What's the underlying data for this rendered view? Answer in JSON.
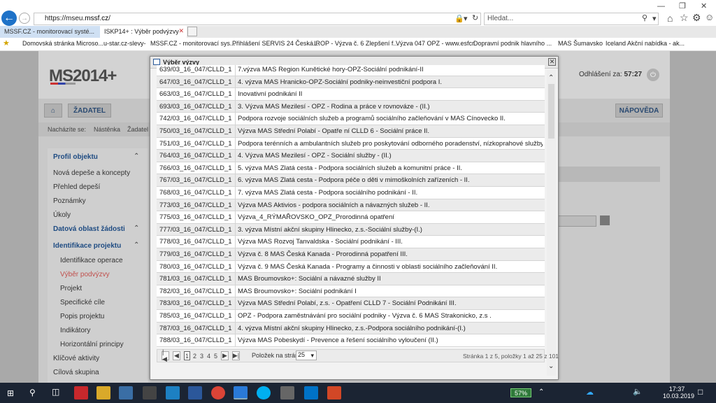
{
  "browser": {
    "url_prefix": "https://mseu.",
    "url_domain": "mssf.cz",
    "url_suffix": "/",
    "search_placeholder": "Hledat...",
    "tabs": [
      {
        "label": "MSSF.CZ - monitorovací systé..."
      },
      {
        "label": "ISKP14+ : Výběr podvýzvy"
      }
    ],
    "favorites": [
      "Domovská stránka Microso...",
      "u-star.cz-slevy-",
      "MSSF.CZ - monitorovací sys...",
      "Přihlášení SERVIS 24 Česká...",
      "IROP - Výzva č. 6 Zlepšení f...",
      "Výzva 047 OPZ - www.esfcr",
      "Dopravní podnik hlavního ...",
      "MAS Šumavsko",
      "Iceland",
      "Akční nabídka - ak..."
    ]
  },
  "page": {
    "logo": "MS2014+",
    "logout_label": "Odhlášení za:",
    "logout_time": "57:27",
    "nav": {
      "zadatel": "ŽADATEL",
      "napoveda": "NÁPOVĚDA"
    },
    "crumbs": {
      "label": "Nacházíte se:",
      "c1": "Nástěnka",
      "c2": "Žadatel"
    },
    "sidebar": [
      {
        "label": "Profil objektu",
        "type": "head"
      },
      {
        "label": "Nová depeše a koncepty",
        "type": "item"
      },
      {
        "label": "Přehled depeší",
        "type": "item"
      },
      {
        "label": "Poznámky",
        "type": "item"
      },
      {
        "label": "Úkoly",
        "type": "item"
      },
      {
        "label": "Datová oblast žádosti",
        "type": "head"
      },
      {
        "label": "Identifikace projektu",
        "type": "head"
      },
      {
        "label": "Identifikace operace",
        "type": "sub"
      },
      {
        "label": "Výběr podvýzvy",
        "type": "sub-active"
      },
      {
        "label": "Projekt",
        "type": "sub"
      },
      {
        "label": "Specifické cíle",
        "type": "sub"
      },
      {
        "label": "Popis projektu",
        "type": "sub"
      },
      {
        "label": "Indikátory",
        "type": "sub"
      },
      {
        "label": "Horizontální principy",
        "type": "sub"
      },
      {
        "label": "Klíčové aktivity",
        "type": "item"
      },
      {
        "label": "Cílová skupina",
        "type": "item"
      }
    ]
  },
  "dialog": {
    "title": "Výběr výzvy",
    "rows": [
      {
        "code": "639/03_16_047/CLLD_15_...",
        "name": "7.výzva MAS Region Kunětické hory-OPZ-Sociální podnikání-II"
      },
      {
        "code": "647/03_16_047/CLLD_15_...",
        "name": "4. výzva MAS Hranicko-OPZ-Sociální podniky-neinvestiční podpora I."
      },
      {
        "code": "663/03_16_047/CLLD_17_...",
        "name": "Inovativní podnikání II"
      },
      {
        "code": "693/03_16_047/CLLD_16_...",
        "name": "3. Výzva MAS Mezilesí - OPZ - Rodina a práce v rovnováze - (II.)"
      },
      {
        "code": "742/03_16_047/CLLD_16_...",
        "name": "Podpora rozvoje sociálních služeb a programů sociálního začleňování v MAS Cínovecko II."
      },
      {
        "code": "750/03_16_047/CLLD_17_...",
        "name": "Výzva MAS Střední Polabí - Opatře ní CLLD 6 - Sociální práce II."
      },
      {
        "code": "751/03_16_047/CLLD_15_...",
        "name": "Podpora terénních a ambulantních služeb pro poskytování odborného poradenství, nízkoprahové služby"
      },
      {
        "code": "764/03_16_047/CLLD_16_...",
        "name": "4. Výzva MAS Mezilesí - OPZ - Sociální služby - (II.)"
      },
      {
        "code": "766/03_16_047/CLLD_17_...",
        "name": "5. výzva MAS Zlatá cesta - Podpora sociálních služeb a komunitní práce - II."
      },
      {
        "code": "767/03_16_047/CLLD_17_...",
        "name": "6. výzva MAS Zlatá cesta - Podpora péče o děti v mimoškolních zařízeních - II."
      },
      {
        "code": "768/03_16_047/CLLD_17_...",
        "name": "7. výzva MAS Zlatá cesta - Podpora sociálního podnikání - II."
      },
      {
        "code": "773/03_16_047/CLLD_16_...",
        "name": "Výzva MAS Aktivios - podpora sociálních a návazných služeb - II."
      },
      {
        "code": "775/03_16_047/CLLD_15_...",
        "name": "Výzva_4_RÝMAŘOVSKO_OPZ_Prorodinná opatření"
      },
      {
        "code": "777/03_16_047/CLLD_15_...",
        "name": "3. výzva Místní akční skupiny Hlinecko, z.s.-Sociální služby-(I.)"
      },
      {
        "code": "778/03_16_047/CLLD_16_...",
        "name": "Výzva MAS Rozvoj Tanvaldska - Sociální podnikání - III."
      },
      {
        "code": "779/03_16_047/CLLD_15_...",
        "name": "Výzva č. 8 MAS Česká Kanada - Prorodinná popatření III."
      },
      {
        "code": "780/03_16_047/CLLD_15_...",
        "name": "Výzva č. 9 MAS Česká Kanada - Programy a činnosti v oblasti sociálního začleňování II."
      },
      {
        "code": "781/03_16_047/CLLD_16_...",
        "name": "MAS Broumovsko+: Sociální a návazné služby II"
      },
      {
        "code": "782/03_16_047/CLLD_16_...",
        "name": "MAS Broumovsko+: Sociální podnikání I"
      },
      {
        "code": "783/03_16_047/CLLD_17_...",
        "name": "Výzva MAS Střední Polabí, z.s. - Opatření CLLD 7 - Sociální Podnikání III."
      },
      {
        "code": "785/03_16_047/CLLD_16_...",
        "name": "OPZ - Podpora zaměstnávání pro sociální podniky - Výzva č. 6 MAS Strakonicko, z.s ."
      },
      {
        "code": "787/03_16_047/CLLD_15_...",
        "name": "4. výzva Místní akční skupiny Hlinecko, z.s.-Podpora sociálního podnikání-(I.)"
      },
      {
        "code": "788/03_16_047/CLLD_15_...",
        "name": "Výzva MAS Pobeskydí - Prevence a řešení sociálního vyloučení (II.)"
      }
    ],
    "pager": {
      "pages": [
        "1",
        "2",
        "3",
        "4",
        "5"
      ],
      "per_page_label": "Položek na stránku",
      "per_page_value": "25",
      "info": "Stránka 1 z 5, položky 1 až 25 z 101"
    }
  },
  "taskbar": {
    "battery": "57%",
    "time": "17:37",
    "date": "10.03.2019"
  }
}
